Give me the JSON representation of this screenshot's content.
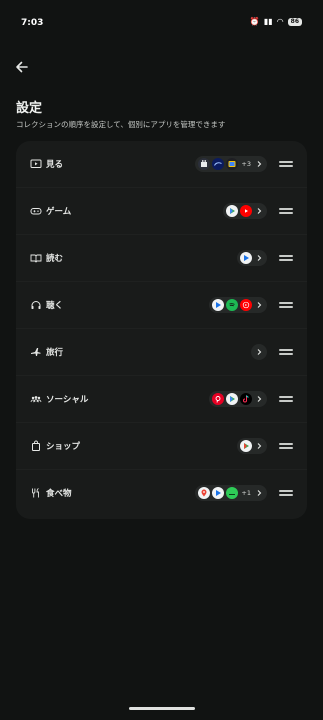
{
  "status": {
    "time": "7:03",
    "battery": "86"
  },
  "header": {
    "title": "設定",
    "subtitle": "コレクションの順序を設定して、個別にアプリを管理できます"
  },
  "collections": [
    {
      "label": "見る",
      "more": "+3"
    },
    {
      "label": "ゲーム"
    },
    {
      "label": "読む"
    },
    {
      "label": "聴く"
    },
    {
      "label": "旅行"
    },
    {
      "label": "ソーシャル"
    },
    {
      "label": "ショップ"
    },
    {
      "label": "食べ物",
      "more": "+1"
    }
  ],
  "colors": {
    "background": "#111312",
    "card": "#191b1a",
    "chip": "#262928",
    "text": "#e6e8e6"
  }
}
